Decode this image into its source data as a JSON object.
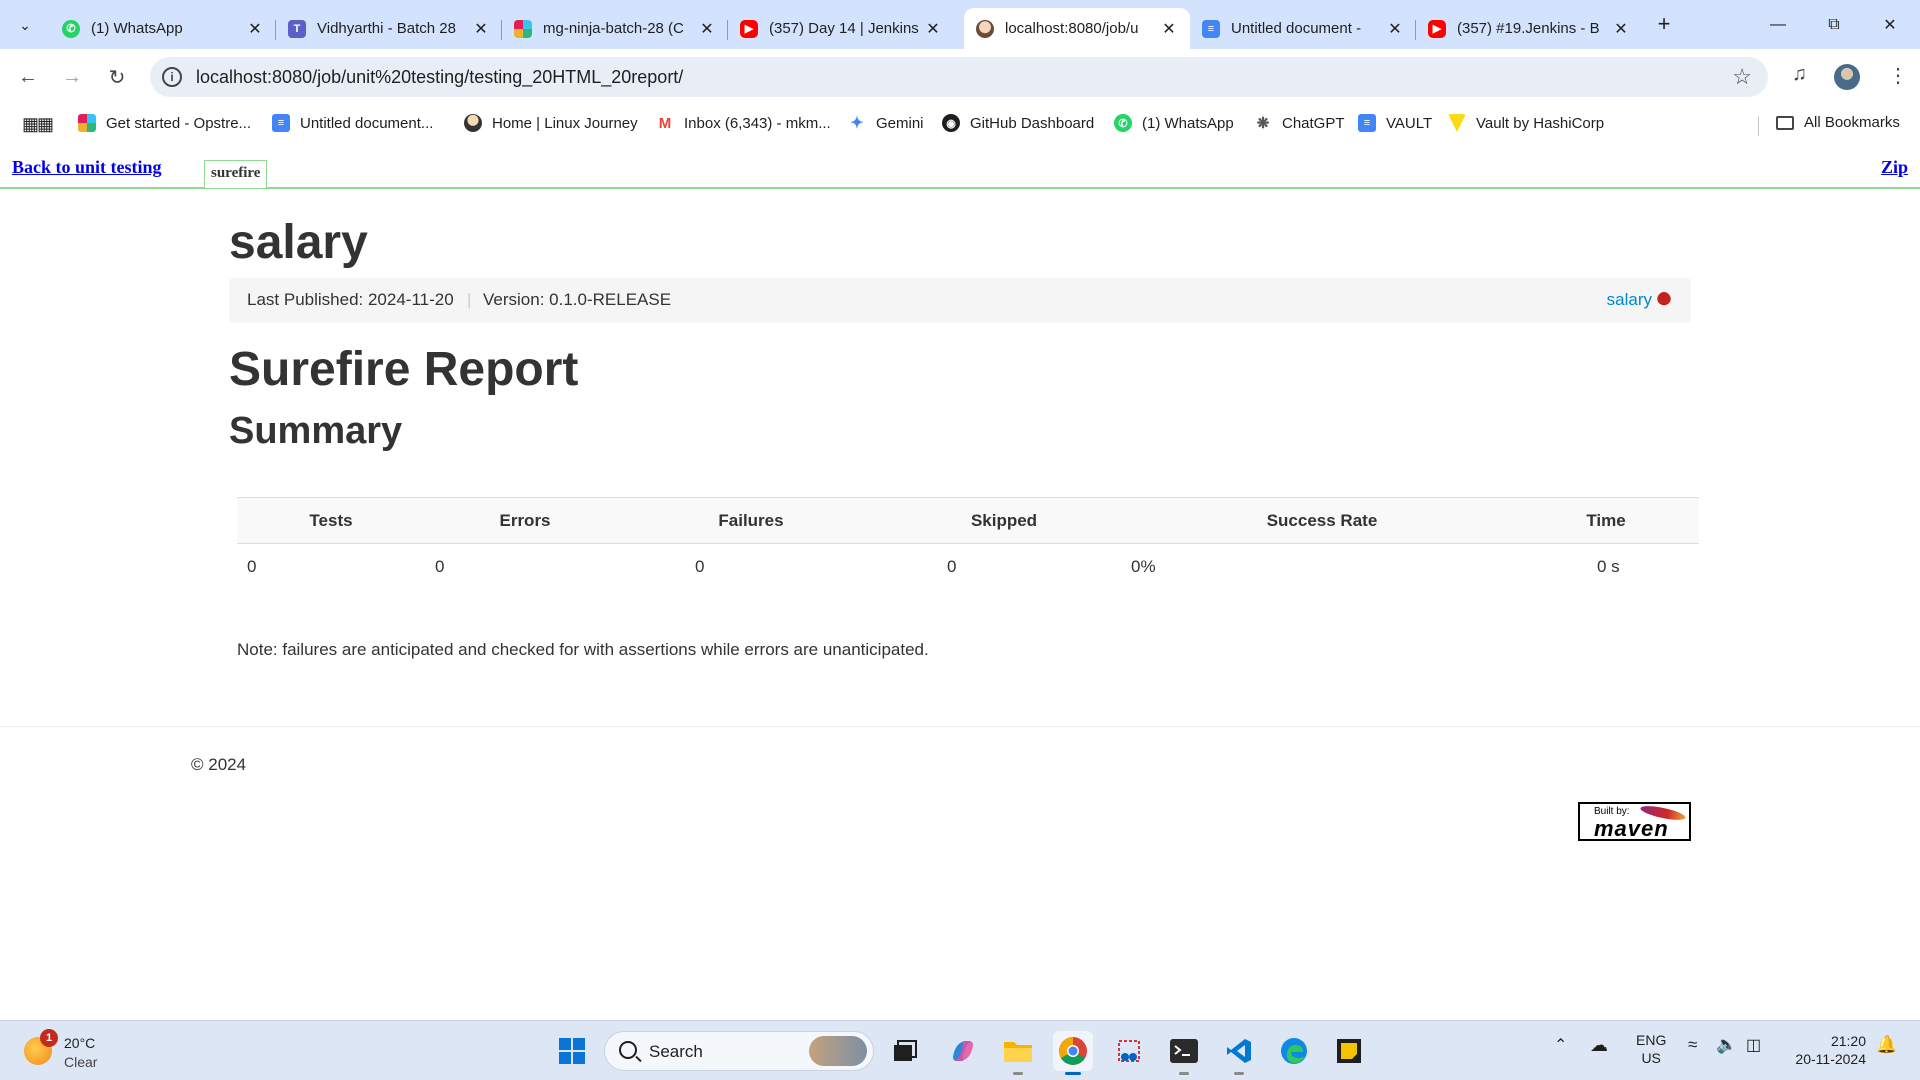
{
  "browser": {
    "tabs": [
      {
        "title": "(1) WhatsApp",
        "icon": "whatsapp-icon",
        "color": "#25d366"
      },
      {
        "title": "Vidhyarthi - Batch 28",
        "icon": "teams-icon",
        "color": "#5b5fc7"
      },
      {
        "title": "mg-ninja-batch-28 (C",
        "icon": "slack-icon",
        "color": "#e01e5a"
      },
      {
        "title": "(357) Day 14 | Jenkins",
        "icon": "youtube-icon",
        "color": "#ff0000"
      },
      {
        "title": "localhost:8080/job/u",
        "icon": "jenkins-icon",
        "color": "#d6bfa8",
        "active": true
      },
      {
        "title": "Untitled document -",
        "icon": "docs-icon",
        "color": "#4285f4"
      },
      {
        "title": "(357) #19.Jenkins - B",
        "icon": "youtube-icon",
        "color": "#ff0000"
      }
    ],
    "url": "localhost:8080/job/unit%20testing/testing_20HTML_20report/",
    "bookmarks": [
      {
        "label": "Get started - Opstre...",
        "icon": "slack-icon",
        "color": "#e01e5a"
      },
      {
        "label": "Untitled document...",
        "icon": "docs-icon",
        "color": "#4285f4"
      },
      {
        "label": "Home | Linux Journey",
        "icon": "tux-icon",
        "color": "#333333"
      },
      {
        "label": "Inbox (6,343) - mkm...",
        "icon": "gmail-icon",
        "color": "#ea4335"
      },
      {
        "label": "Gemini",
        "icon": "gemini-icon",
        "color": "#4285f4"
      },
      {
        "label": "GitHub Dashboard",
        "icon": "github-icon",
        "color": "#1f1f1f"
      },
      {
        "label": "(1) WhatsApp",
        "icon": "whatsapp-icon",
        "color": "#25d366"
      },
      {
        "label": "ChatGPT",
        "icon": "chatgpt-icon",
        "color": "#555555"
      },
      {
        "label": "VAULT",
        "icon": "docs-icon",
        "color": "#4285f4"
      },
      {
        "label": "Vault by HashiCorp",
        "icon": "vault-icon",
        "color": "#ffd814"
      }
    ],
    "all_bookmarks": "All Bookmarks"
  },
  "jenkins": {
    "back_link": "Back to unit testing",
    "report_tab": "surefire",
    "zip_link": "Zip"
  },
  "site": {
    "project_name": "salary",
    "last_published": "Last Published: 2024-11-20",
    "divider": "|",
    "version": "Version: 0.1.0-RELEASE",
    "project_link": "salary",
    "heading": "Surefire Report",
    "subheading": "Summary",
    "summary_table": {
      "columns": [
        "Tests",
        "Errors",
        "Failures",
        "Skipped",
        "Success Rate",
        "Time"
      ],
      "rows": [
        [
          "0",
          "0",
          "0",
          "0",
          "0%",
          "0 s"
        ]
      ]
    },
    "note": "Note: failures are anticipated and checked for with assertions while errors are unanticipated.",
    "copyright": "© 2024",
    "maven_badge_built": "Built by:",
    "maven_badge_name": "maven"
  },
  "taskbar": {
    "weather_badge": "1",
    "temperature": "20°C",
    "condition": "Clear",
    "search_label": "Search",
    "language": "ENG",
    "region": "US",
    "time": "21:20",
    "date": "20-11-2024"
  }
}
